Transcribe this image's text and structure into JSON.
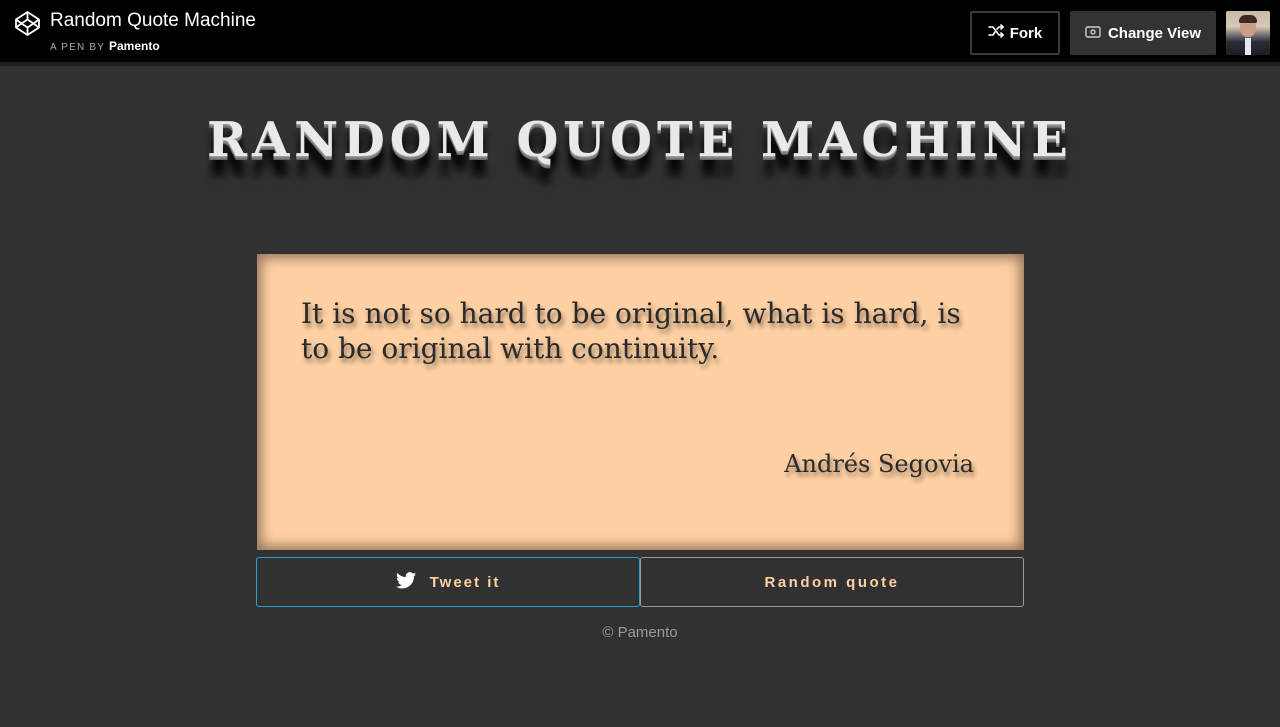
{
  "header": {
    "pen_title": "Random Quote Machine",
    "pen_by_label": "A PEN BY",
    "author": "Pamento",
    "fork_label": "Fork",
    "change_view_label": "Change View"
  },
  "main": {
    "title": "RANDOM QUOTE MACHINE",
    "quote": {
      "text": "It is not so hard to be original, what is hard, is to be original with continuity.",
      "author": "Andrés Segovia"
    },
    "tweet_label": "Tweet it",
    "random_label": "Random quote",
    "footer": "© Pamento"
  },
  "colors": {
    "background": "#323132",
    "card": "#fed0a3",
    "button_text": "#fed0a3",
    "tweet_border": "#2a9fd6"
  },
  "icons": {
    "logo": "codepen-icon",
    "fork": "fork-icon",
    "change_view": "eye-icon",
    "tweet": "twitter-icon"
  }
}
